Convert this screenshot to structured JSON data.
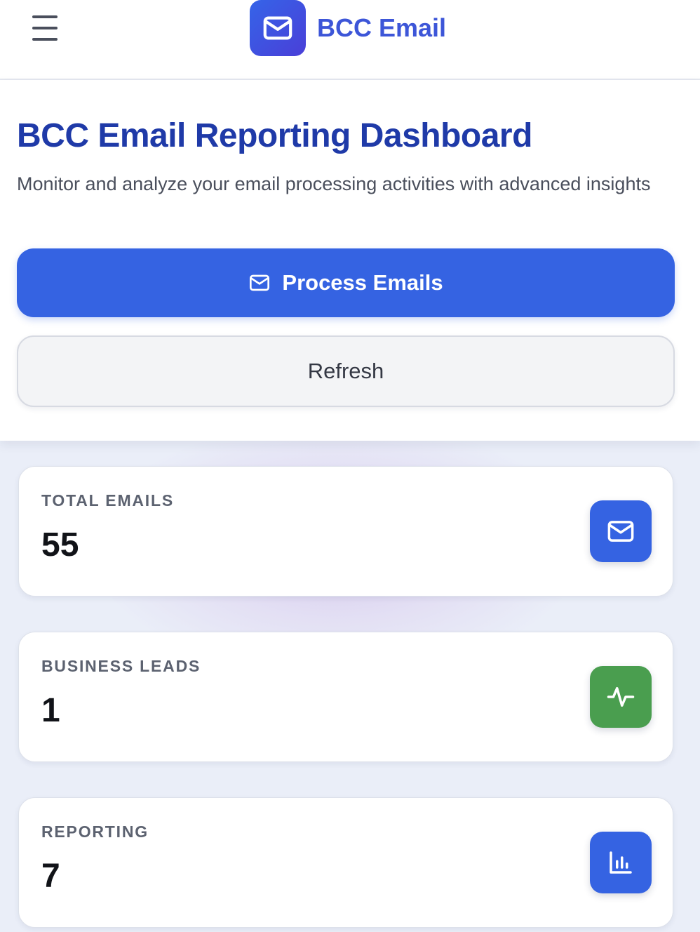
{
  "header": {
    "brand_title": "BCC Email",
    "menu_icon": "hamburger-menu-icon",
    "logo_icon": "mail-icon"
  },
  "hero": {
    "title": "BCC Email Reporting Dashboard",
    "subtitle": "Monitor and analyze your email processing activities with advanced insights",
    "process_button_label": "Process Emails",
    "process_button_icon": "mail-icon",
    "refresh_button_label": "Refresh"
  },
  "stats": [
    {
      "label": "TOTAL EMAILS",
      "value": "55",
      "icon": "mail-icon",
      "color": "#3563e2"
    },
    {
      "label": "BUSINESS LEADS",
      "value": "1",
      "icon": "activity-icon",
      "color": "#4a9e4f"
    },
    {
      "label": "REPORTING",
      "value": "7",
      "icon": "bar-chart-icon",
      "color": "#3563e2"
    }
  ],
  "colors": {
    "primary": "#3563e2",
    "brand_text": "#3d56d8",
    "title_text": "#1f3aa8",
    "success": "#4a9e4f"
  }
}
